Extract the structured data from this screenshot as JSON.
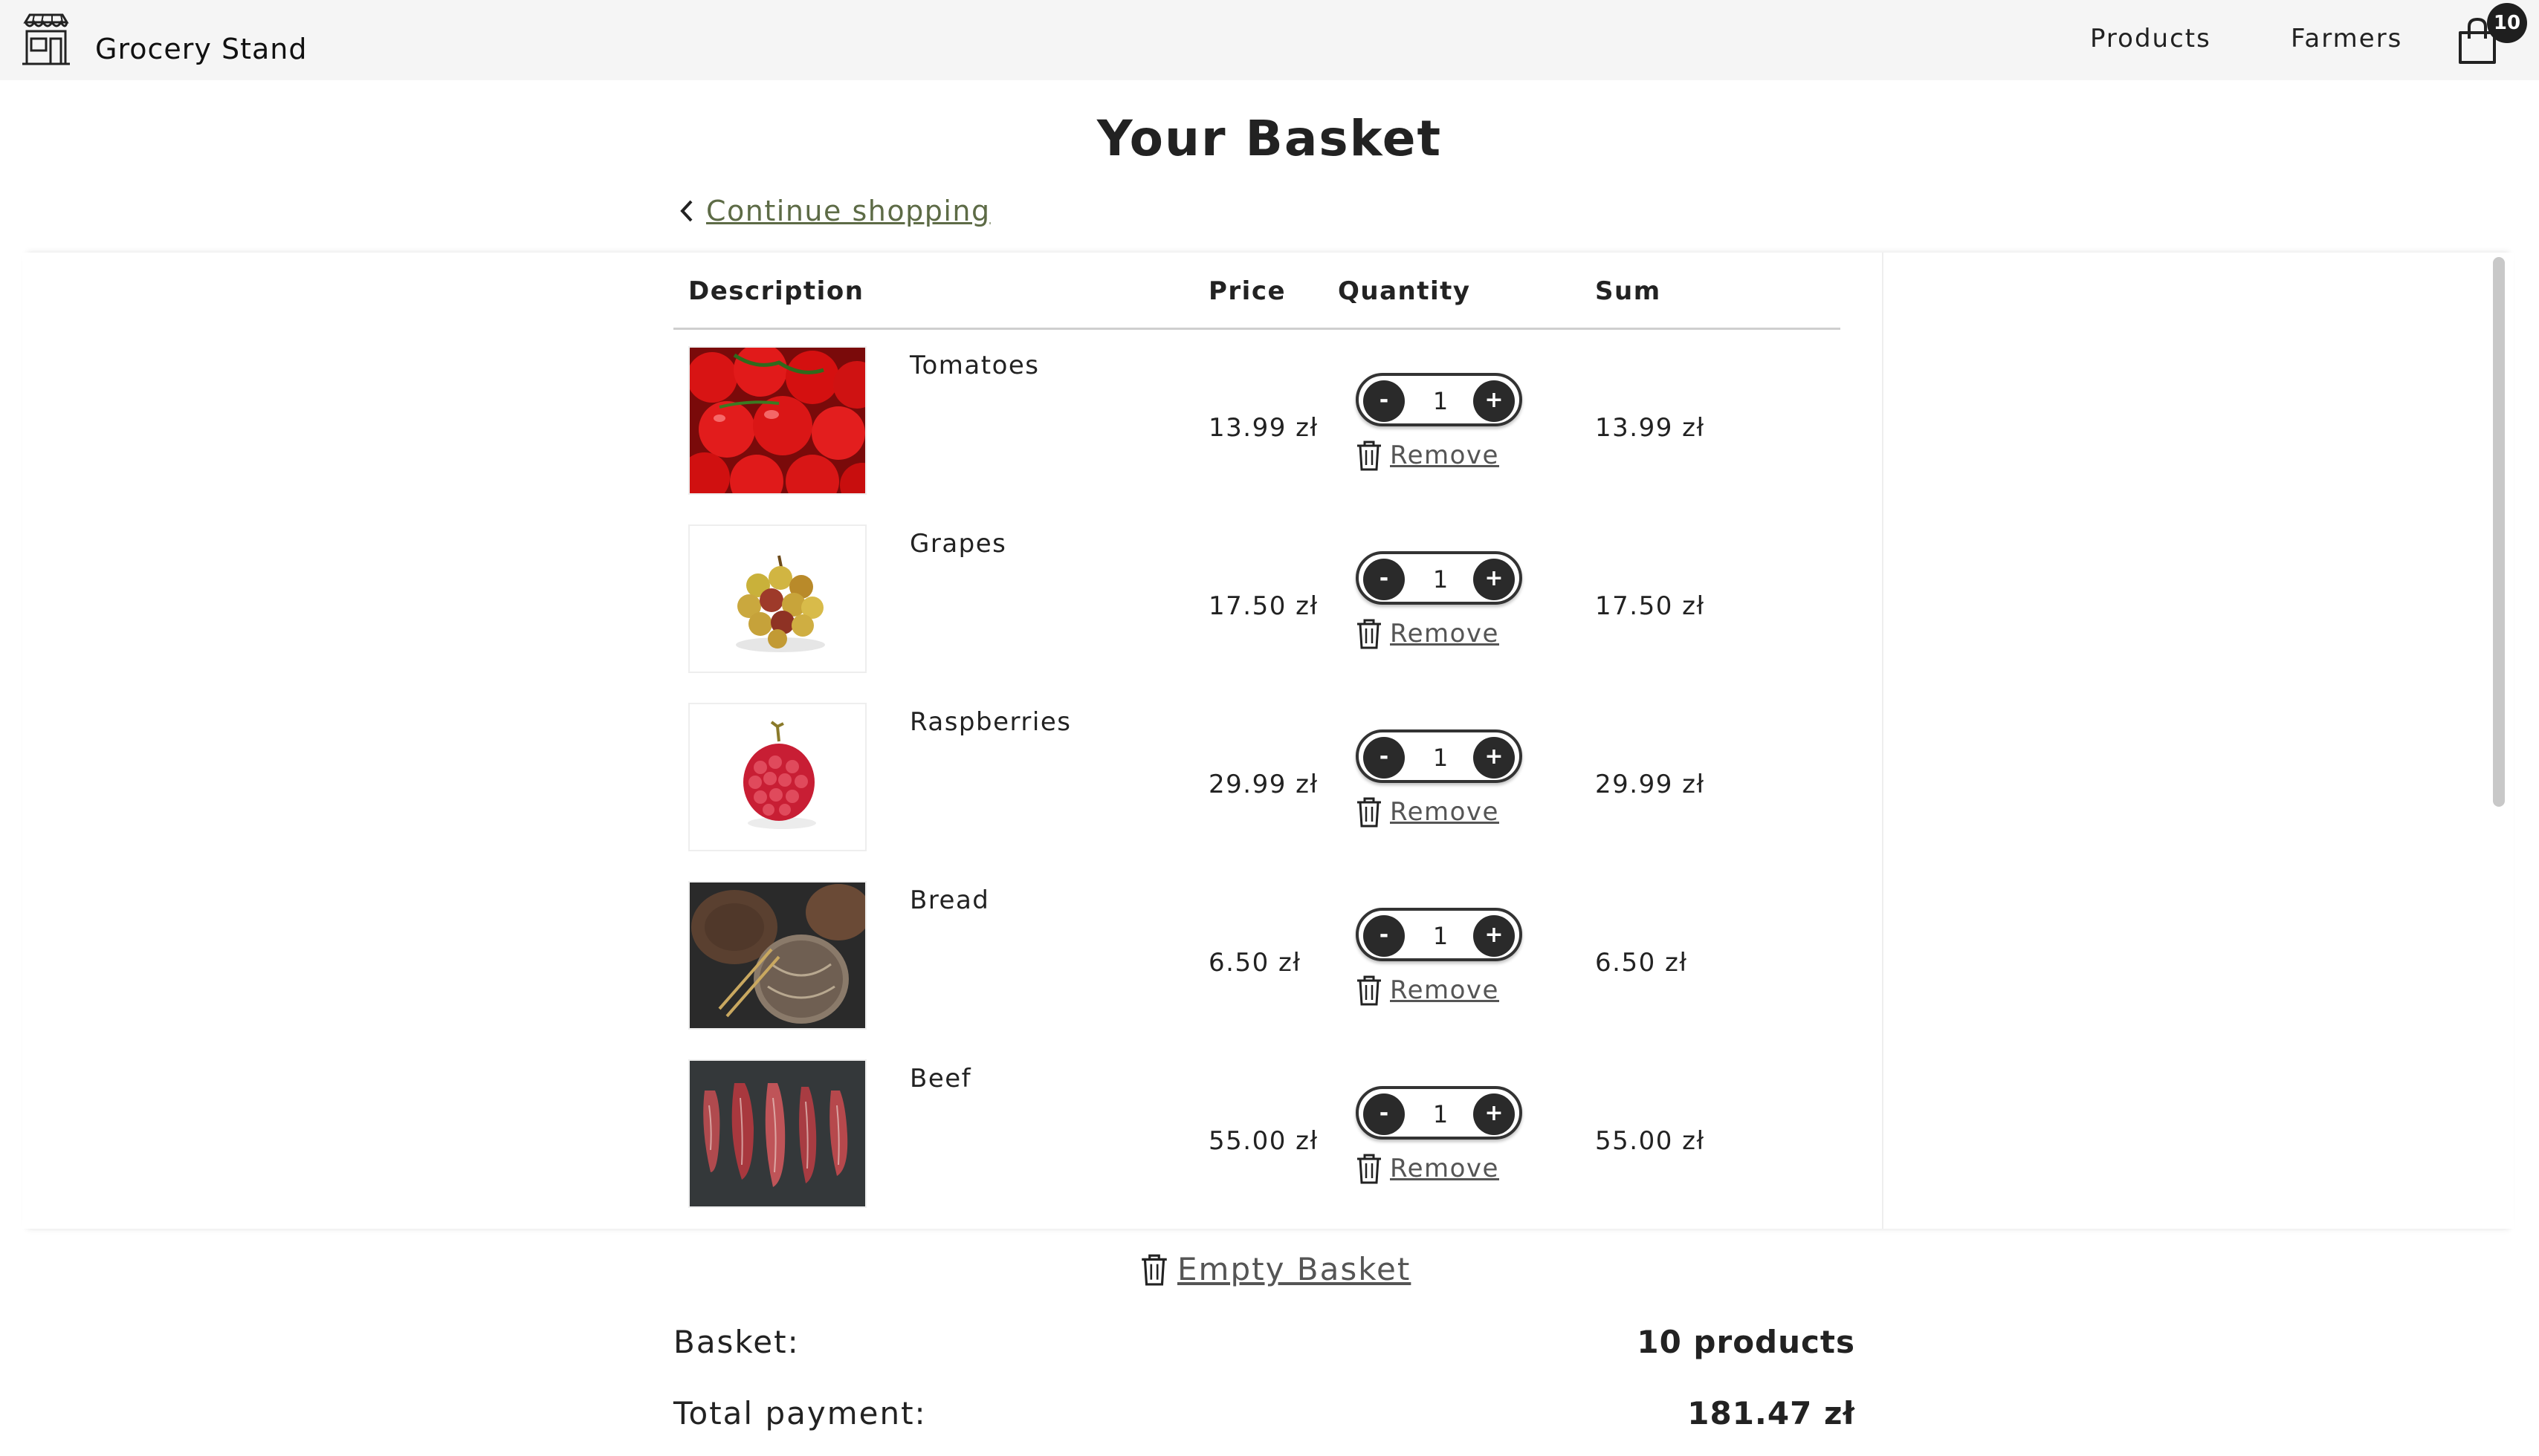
{
  "header": {
    "brand": "Grocery Stand",
    "nav": [
      {
        "label": "Products"
      },
      {
        "label": "Farmers"
      }
    ],
    "cart_count": "10"
  },
  "page": {
    "title": "Your Basket",
    "continue_label": "Continue shopping"
  },
  "table": {
    "columns": {
      "description": "Description",
      "price": "Price",
      "quantity": "Quantity",
      "sum": "Sum"
    },
    "remove_label": "Remove",
    "items": [
      {
        "name": "Tomatoes",
        "price": "13.99 zł",
        "quantity": "1",
        "sum": "13.99 zł",
        "image": "tomatoes"
      },
      {
        "name": "Grapes",
        "price": "17.50 zł",
        "quantity": "1",
        "sum": "17.50 zł",
        "image": "grapes"
      },
      {
        "name": "Raspberries",
        "price": "29.99 zł",
        "quantity": "1",
        "sum": "29.99 zł",
        "image": "raspberry"
      },
      {
        "name": "Bread",
        "price": "6.50 zł",
        "quantity": "1",
        "sum": "6.50 zł",
        "image": "bread"
      },
      {
        "name": "Beef",
        "price": "55.00 zł",
        "quantity": "1",
        "sum": "55.00 zł",
        "image": "beef"
      }
    ],
    "minus_symbol": "-",
    "plus_symbol": "+"
  },
  "summary": {
    "empty_label": "Empty Basket",
    "basket_label": "Basket:",
    "basket_value": "10 products",
    "total_label": "Total payment:",
    "total_value": "181.47 zł"
  }
}
